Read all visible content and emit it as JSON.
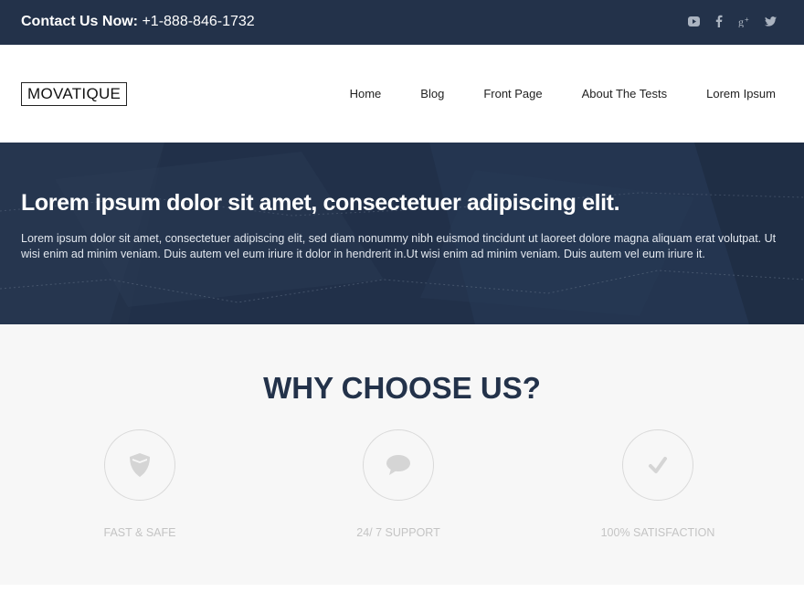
{
  "topbar": {
    "contact_label": "Contact Us Now:",
    "phone": "+1-888-846-1732",
    "social_icons": [
      "youtube-icon",
      "facebook-icon",
      "google-plus-icon",
      "twitter-icon"
    ]
  },
  "header": {
    "logo": "MOVATIQUE",
    "nav": [
      {
        "label": "Home"
      },
      {
        "label": "Blog"
      },
      {
        "label": "Front Page"
      },
      {
        "label": "About The Tests"
      },
      {
        "label": "Lorem Ipsum"
      }
    ]
  },
  "hero": {
    "title": "Lorem ipsum dolor sit amet, consectetuer adipiscing elit.",
    "text": "Lorem ipsum dolor sit amet, consectetuer adipiscing elit, sed diam nonummy nibh euismod tincidunt ut laoreet dolore magna aliquam erat volutpat. Ut wisi enim ad minim veniam. Duis autem vel eum iriure it dolor in hendrerit in.Ut wisi enim ad minim veniam. Duis autem vel eum iriure it."
  },
  "why": {
    "title": "WHY CHOOSE US?",
    "features": [
      {
        "label": "FAST & SAFE",
        "icon": "shield-icon"
      },
      {
        "label": "24/ 7 SUPPORT",
        "icon": "chat-bubble-icon"
      },
      {
        "label": "100% SATISFACTION",
        "icon": "checkmark-icon"
      }
    ]
  },
  "colors": {
    "navy": "#23324a",
    "light_gray_bg": "#f7f7f7",
    "muted_label": "#c4c4c4"
  }
}
